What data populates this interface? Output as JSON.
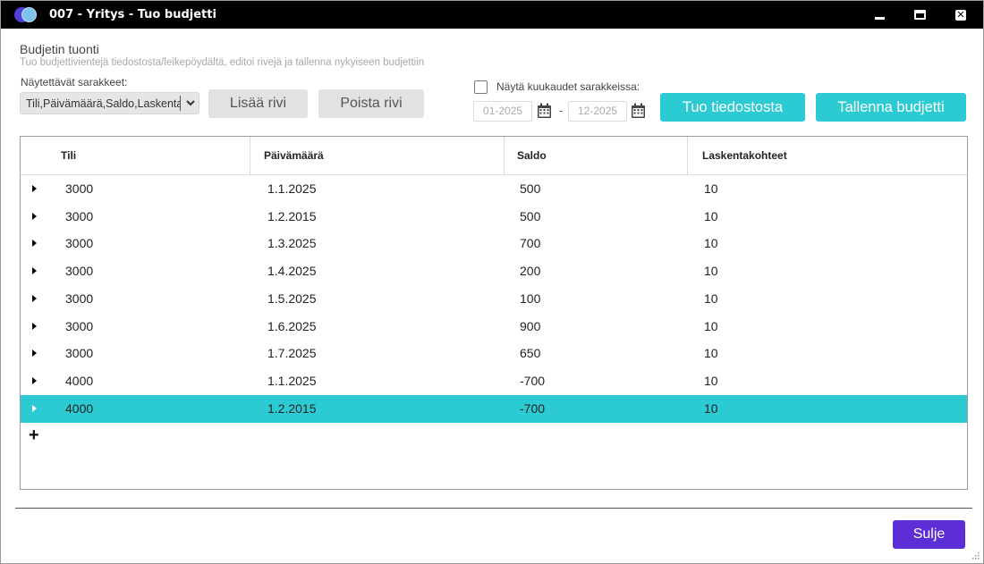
{
  "window": {
    "title": "007 - Yritys  - Tuo budjetti"
  },
  "header": {
    "title": "Budjetin tuonti",
    "subtitle": "Tuo budjettivientejä tiedostosta/leikepöydältä, editoi rivejä ja tallenna nykyiseen budjettiin"
  },
  "columns_selector": {
    "label": "Näytettävät sarakkeet:",
    "value": "Tili,Päivämäärä,Saldo,Laskentakohteet"
  },
  "toolbar": {
    "add_row": "Lisää rivi",
    "remove_row": "Poista rivi",
    "show_months_label": "Näytä kuukaudet sarakkeissa:",
    "date_from": "01-2025",
    "date_to": "12-2025",
    "date_separator": "-",
    "import_file": "Tuo tiedostosta",
    "save_budget": "Tallenna budjetti"
  },
  "grid": {
    "headers": [
      "Tili",
      "Päivämäärä",
      "Saldo",
      "Laskentakohteet"
    ],
    "rows": [
      {
        "account": "3000",
        "date": "1.1.2025",
        "balance": "500",
        "cost_center": "10"
      },
      {
        "account": "3000",
        "date": "1.2.2015",
        "balance": "500",
        "cost_center": "10"
      },
      {
        "account": "3000",
        "date": "1.3.2025",
        "balance": "700",
        "cost_center": "10"
      },
      {
        "account": "3000",
        "date": "1.4.2025",
        "balance": "200",
        "cost_center": "10"
      },
      {
        "account": "3000",
        "date": "1.5.2025",
        "balance": "100",
        "cost_center": "10"
      },
      {
        "account": "3000",
        "date": "1.6.2025",
        "balance": "900",
        "cost_center": "10"
      },
      {
        "account": "3000",
        "date": "1.7.2025",
        "balance": "650",
        "cost_center": "10"
      },
      {
        "account": "4000",
        "date": "1.1.2025",
        "balance": "-700",
        "cost_center": "10"
      },
      {
        "account": "4000",
        "date": "1.2.2015",
        "balance": "-700",
        "cost_center": "10"
      }
    ],
    "selected_row": 8,
    "add_row_symbol": "+"
  },
  "footer": {
    "close": "Sulje"
  },
  "colors": {
    "accent": "#2ccad3",
    "primary": "#5c2fd6",
    "titlebar": "#000000"
  }
}
